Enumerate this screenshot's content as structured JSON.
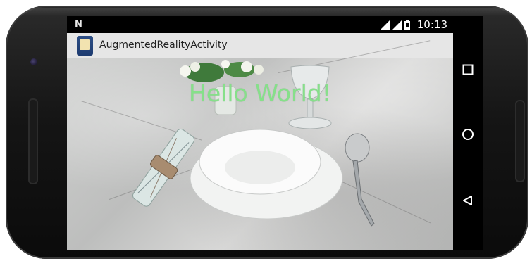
{
  "status_bar": {
    "notification_icon": "n-notification-icon",
    "time": "10:13"
  },
  "app_bar": {
    "title": "AugmentedRealityActivity",
    "icon": "app-launcher-icon"
  },
  "camera_view": {
    "overlay_text": "Hello World!",
    "overlay_color": "#86e08a"
  },
  "nav_bar": {
    "buttons": [
      "recents-square-icon",
      "home-circle-icon",
      "back-triangle-icon"
    ]
  }
}
